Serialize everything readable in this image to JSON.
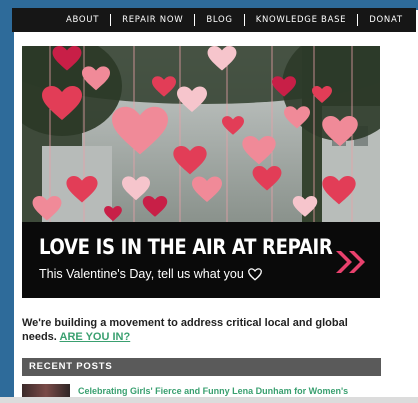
{
  "nav": {
    "items": [
      "ABOUT",
      "REPAIR NOW",
      "BLOG",
      "KNOWLEDGE BASE",
      "DONAT"
    ]
  },
  "banner": {
    "title": "LOVE IS IN THE AIR AT REPAIR",
    "subtitle": "This Valentine's Day, tell us what you",
    "accent_color": "#e8416d"
  },
  "intro": {
    "text": "We're building a movement to address critical local and global needs.",
    "link": "ARE YOU IN?"
  },
  "recent_posts": {
    "heading": "RECENT POSTS",
    "posts": [
      {
        "title": "Celebrating Girls' Fierce and Funny Lena Dunham for Women's"
      }
    ]
  },
  "colors": {
    "frame_blue": "#2e6b9a",
    "nav_bg": "#161616",
    "link_green": "#3aa070",
    "section_gray": "#5a5a5a"
  }
}
